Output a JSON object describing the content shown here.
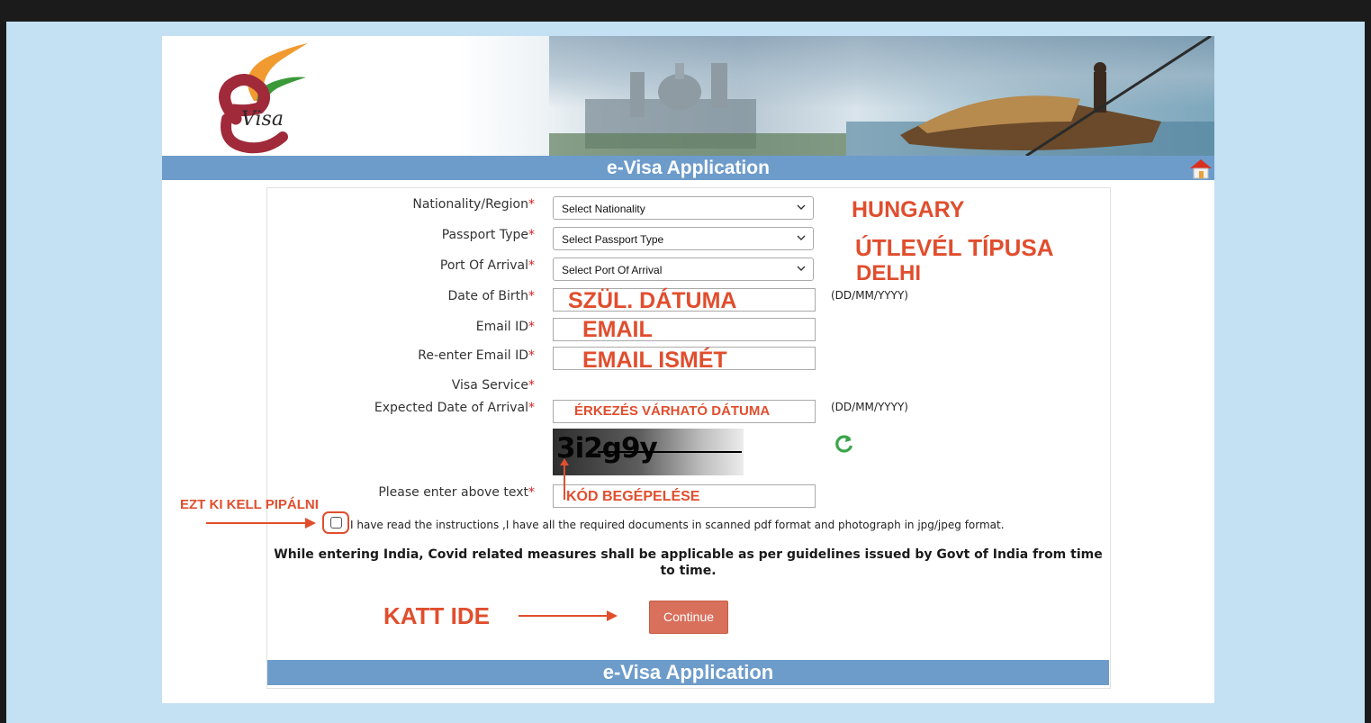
{
  "app": {
    "logo_text": "Visa",
    "title_top": "e-Visa Application",
    "title_bottom": "e-Visa Application"
  },
  "form": {
    "nationality": {
      "label": "Nationality/Region",
      "value": "Select Nationality"
    },
    "passport_type": {
      "label": "Passport Type",
      "value": "Select Passport Type"
    },
    "port_of_arrival": {
      "label": "Port Of Arrival",
      "value": "Select Port Of Arrival"
    },
    "dob": {
      "label": "Date of Birth",
      "hint": "(DD/MM/YYYY)"
    },
    "email": {
      "label": "Email ID"
    },
    "email_confirm": {
      "label": "Re-enter Email ID"
    },
    "visa_service": {
      "label": "Visa Service"
    },
    "arrival_date": {
      "label": "Expected Date of Arrival",
      "hint": "(DD/MM/YYYY)"
    },
    "captcha": {
      "text": "3i2g9y",
      "label": "Please enter above text"
    },
    "required_mark": "*",
    "agreement": "I have read the instructions ,I have all the required documents in scanned pdf format and photograph in jpg/jpeg format.",
    "covid_notice": "While entering India, Covid related measures shall be applicable as per guidelines issued by Govt of India from time to time.",
    "continue_label": "Continue"
  },
  "annotations": {
    "hungary": "HUNGARY",
    "passport_type": "ÚTLEVÉL TÍPUSA",
    "delhi": "DELHI",
    "dob": "SZÜL. DÁTUMA",
    "email": "EMAIL",
    "email_again": "EMAIL ISMÉT",
    "arrival_date": "ÉRKEZÉS VÁRHATÓ DÁTUMA",
    "captcha_entry": "KÓD BEGÉPELÉSE",
    "checkbox_note": "EZT KI KELL PIPÁLNI",
    "click_here": "KATT IDE"
  },
  "colors": {
    "annotation": "#e04e2e",
    "bar": "#6d9ccb",
    "button": "#d9705c",
    "page_bg": "#c4e0f3"
  },
  "icons": [
    "chevron-down-icon",
    "home-icon",
    "refresh-icon",
    "arrow-icon"
  ]
}
